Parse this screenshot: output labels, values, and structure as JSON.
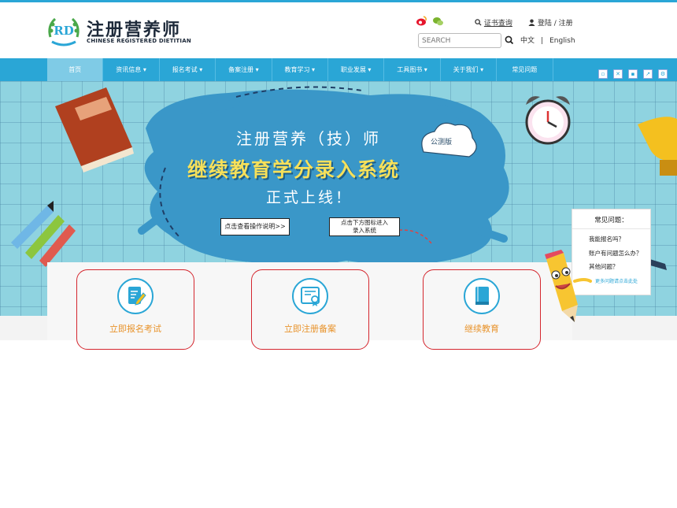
{
  "header": {
    "logo_mark": "RD",
    "logo_cn": "注册营养师",
    "logo_en": "CHINESE REGISTERED DIETITIAN",
    "cert_link": "证书查询",
    "login": "登陆 / 注册",
    "search_placeholder": "SEARCH",
    "lang_cn": "中文",
    "lang_sep": "|",
    "lang_en": "English"
  },
  "nav": {
    "items": [
      {
        "label": "首页"
      },
      {
        "label": "资讯信息 ▾"
      },
      {
        "label": "报名考试 ▾"
      },
      {
        "label": "备案注册 ▾"
      },
      {
        "label": "教育学习 ▾"
      },
      {
        "label": "职业发展 ▾"
      },
      {
        "label": "工具图书 ▾"
      },
      {
        "label": "关于我们 ▾"
      },
      {
        "label": "常见问题"
      }
    ],
    "active_index": 0
  },
  "banner": {
    "line1": "注册营养（技）师",
    "line2": "继续教育学分录入系统",
    "line3": "正式上线！",
    "badge": "公测版",
    "button1": "点击查看操作说明>>",
    "button2_line1": "点击下方图标进入",
    "button2_line2": "录入系统"
  },
  "cards": [
    {
      "label": "立即报名考试",
      "icon": "edit-document-icon"
    },
    {
      "label": "立即注册备案",
      "icon": "certificate-icon"
    },
    {
      "label": "继续教育",
      "icon": "book-icon"
    }
  ],
  "faq": {
    "title": "常见问题：",
    "questions": [
      "我能报名吗？",
      "账户有问题怎么办？",
      "其他问题？"
    ],
    "more": "更多问题请点击此处"
  },
  "colors": {
    "brand_blue": "#2aa6d6",
    "card_border": "#d4262e",
    "card_label": "#e8932b",
    "banner_title": "#f6e05a"
  }
}
